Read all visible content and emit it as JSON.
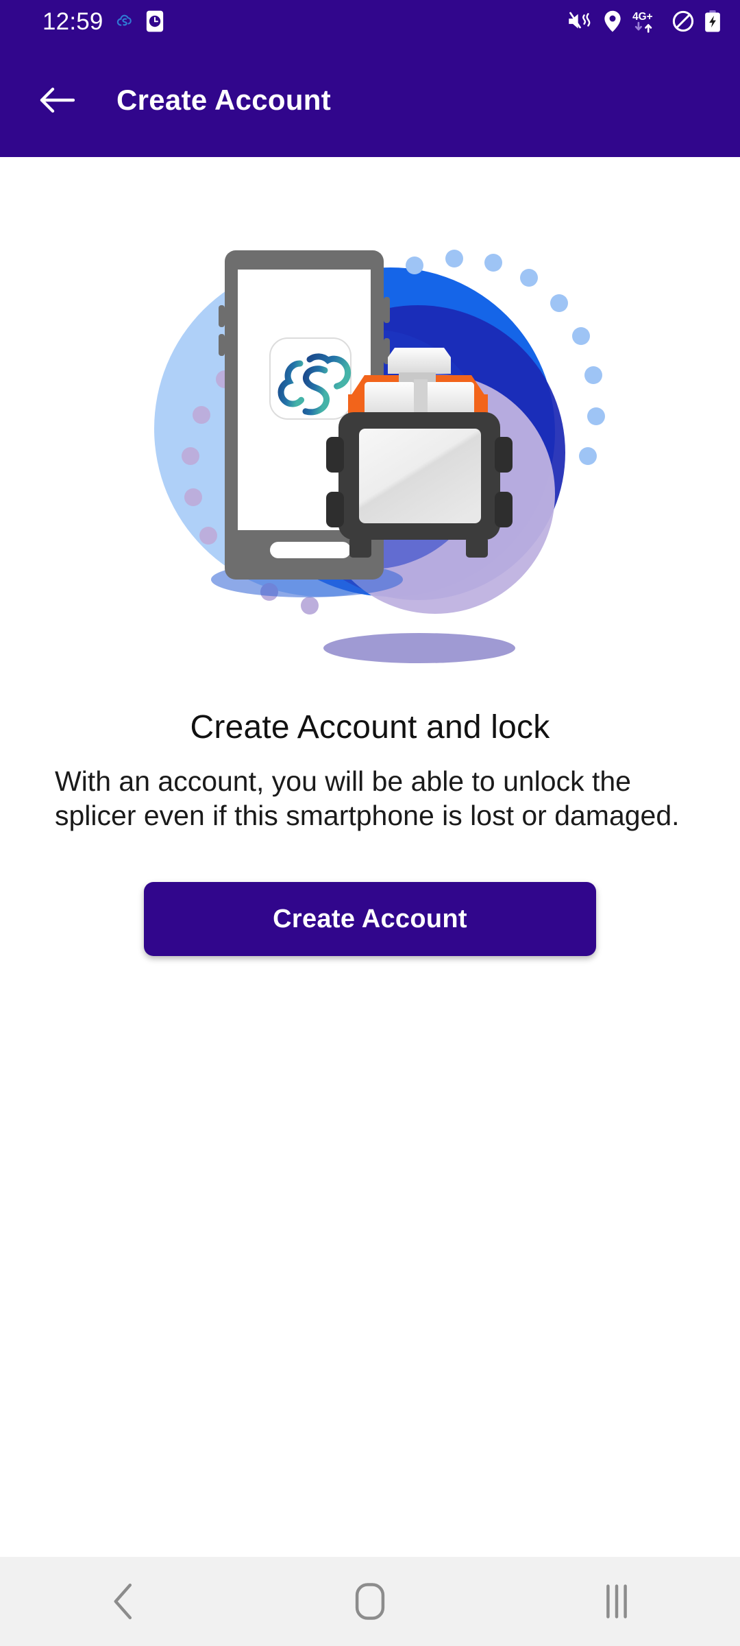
{
  "status_bar": {
    "clock": "12:59",
    "left_icons": [
      {
        "name": "cloud-app-notification-icon"
      },
      {
        "name": "alarm-clock-icon"
      }
    ],
    "right_icons": [
      {
        "name": "mute-vibrate-icon"
      },
      {
        "name": "location-pin-icon"
      },
      {
        "name": "network-4g-plus-icon",
        "label": "4G+"
      },
      {
        "name": "do-not-disturb-icon"
      },
      {
        "name": "battery-charging-icon"
      }
    ],
    "background_color": "#31068C"
  },
  "app_bar": {
    "title": "Create Account",
    "back_label": "Back",
    "background_color": "#31068C",
    "title_color": "#FFFFFF"
  },
  "illustration": {
    "name": "splicer-and-smartphone-illustration",
    "phone_logo_name": "cloud-s-logo",
    "colors": {
      "light_blue_circle": "#AFD0F8",
      "mid_blue_circle": "#1565E8",
      "dark_blue_circle": "#1B28B4",
      "deep_blue_circle": "#2318A8",
      "purple_circle": "#BFB2E0",
      "dot_blue": "#9EC4F5",
      "dot_purple": "#BCAEDC",
      "phone_body": "#6E6E6E",
      "phone_screen": "#FFFFFF",
      "splicer_body": "#3C3C3C",
      "splicer_top": "#F2641B",
      "splicer_clamp": "#F0F0F0",
      "splicer_screen": "#EFEFEF",
      "logo_gradient_start": "#1B4A8C",
      "logo_gradient_end": "#45B3A8"
    }
  },
  "main": {
    "headline": "Create Account and lock",
    "body": "With an account, you will be able to unlock the splicer even if this smartphone is lost or damaged.",
    "cta_label": "Create Account",
    "cta_color": "#31068C"
  },
  "nav_bar": {
    "background_color": "#F1F1F1",
    "icon_color": "#8C8C8C",
    "items": [
      {
        "name": "nav-back-button",
        "label": "Back"
      },
      {
        "name": "nav-home-button",
        "label": "Home"
      },
      {
        "name": "nav-recents-button",
        "label": "Recents"
      }
    ]
  }
}
